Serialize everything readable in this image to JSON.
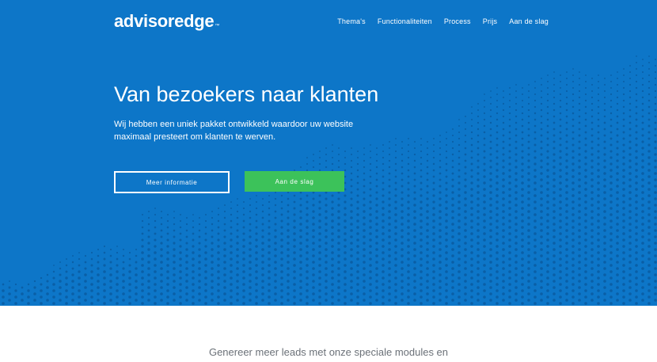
{
  "header": {
    "logo_text": "advisoredge",
    "logo_mark": "™",
    "nav": [
      {
        "label": "Thema's"
      },
      {
        "label": "Functionaliteiten"
      },
      {
        "label": "Process"
      },
      {
        "label": "Prijs"
      },
      {
        "label": "Aan de slag"
      }
    ]
  },
  "hero": {
    "title": "Van bezoekers naar klanten",
    "subtitle": "Wij hebben een uniek pakket ontwikkeld waardoor uw website maximaal presteert om klanten te werven.",
    "primary_button": "Meer informatie",
    "secondary_button": "Aan de slag",
    "colors": {
      "background": "#0d76c8",
      "button_green": "#3cc25a",
      "dots": "#0a5fa6"
    }
  },
  "section": {
    "intro": "Genereer meer leads met onze speciale modules en"
  }
}
